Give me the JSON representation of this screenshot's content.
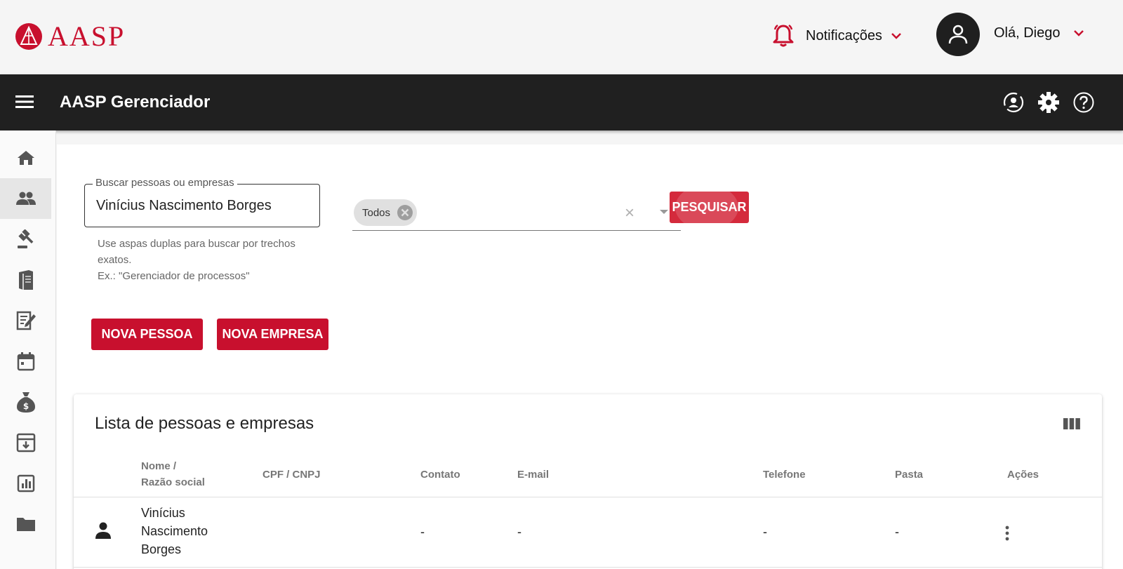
{
  "header": {
    "logo_text": "AASP",
    "notifications_label": "Notificações",
    "user_greeting": "Olá, Diego"
  },
  "appbar": {
    "title": "AASP Gerenciador",
    "icons": [
      "account-sync-icon",
      "gear-icon",
      "help-icon"
    ]
  },
  "sidebar": {
    "items": [
      {
        "icon": "home-icon"
      },
      {
        "icon": "people-icon",
        "active": true
      },
      {
        "icon": "gavel-icon"
      },
      {
        "icon": "book-icon"
      },
      {
        "icon": "edit-document-icon"
      },
      {
        "icon": "calendar-icon"
      },
      {
        "icon": "money-bag-icon"
      },
      {
        "icon": "archive-download-icon"
      },
      {
        "icon": "chart-icon"
      },
      {
        "icon": "folder-icon"
      }
    ]
  },
  "search": {
    "label": "Buscar pessoas ou empresas",
    "value": "Vinícius Nascimento Borges",
    "helper_line1": "Use aspas duplas para buscar por trechos exatos.",
    "helper_line2": "Ex.: \"Gerenciador de processos\""
  },
  "filter": {
    "chip_label": "Todos",
    "clear_symbol": "×"
  },
  "buttons": {
    "search": "PESQUISAR",
    "new_person": "NOVA PESSOA",
    "new_company": "NOVA EMPRESA"
  },
  "table": {
    "title": "Lista de pessoas e empresas",
    "columns": {
      "name_line1": "Nome /",
      "name_line2": "Razão social",
      "cpf": "CPF / CNPJ",
      "contact": "Contato",
      "email": "E-mail",
      "phone": "Telefone",
      "folder": "Pasta",
      "actions": "Ações"
    },
    "rows": [
      {
        "type_icon": "person-icon",
        "name_line1": "Vinícius",
        "name_line2": "Nascimento",
        "name_line3": "Borges",
        "cpf": "",
        "contact": "-",
        "email": "-",
        "phone": "-",
        "folder": "-"
      }
    ]
  },
  "colors": {
    "brand_red": "#c8102e",
    "appbar": "#202020"
  }
}
